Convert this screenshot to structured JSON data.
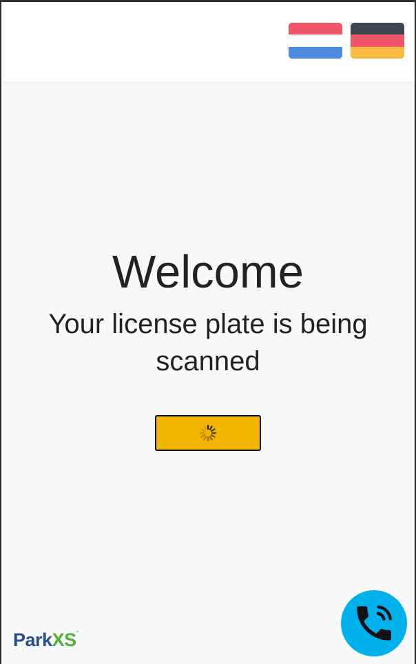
{
  "header": {
    "languages": [
      {
        "name": "Dutch",
        "code": "nl",
        "colors": [
          "#f0566a",
          "#ffffff",
          "#4f8be1"
        ]
      },
      {
        "name": "German",
        "code": "de",
        "colors": [
          "#3f4653",
          "#f0566a",
          "#f7bb43"
        ]
      }
    ]
  },
  "main": {
    "title": "Welcome",
    "subtitle": "Your license plate is being scanned",
    "scan_button": {
      "state": "loading",
      "color": "#f2b600"
    }
  },
  "footer": {
    "logo": {
      "part1": "Park",
      "part2": "XS",
      "mark": "°"
    },
    "call_button": {
      "icon": "phone-call-icon",
      "color": "#00b0ea"
    }
  }
}
